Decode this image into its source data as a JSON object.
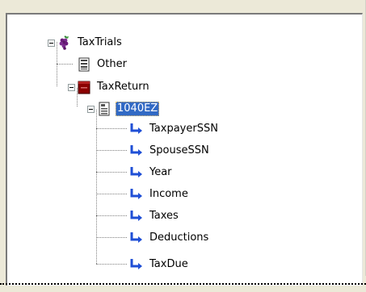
{
  "tree": {
    "root": {
      "label": "TaxTrials",
      "icon": "grapes-database-icon",
      "expanded": true,
      "children": [
        {
          "label": "Other",
          "icon": "document-icon"
        },
        {
          "label": "TaxReturn",
          "icon": "red-folder-icon",
          "expanded": true,
          "children": [
            {
              "label": "1040EZ",
              "icon": "form-document-icon",
              "expanded": true,
              "selected": true,
              "fields": [
                "TaxpayerSSN",
                "SpouseSSN",
                "Year",
                "Income",
                "Taxes",
                "Deductions",
                "TaxDue"
              ]
            }
          ]
        }
      ]
    }
  },
  "colors": {
    "selection": "#316ac5",
    "arrow": "#1f4fd6",
    "folder": "#8b0000",
    "grapes": "#7b2d8e"
  }
}
